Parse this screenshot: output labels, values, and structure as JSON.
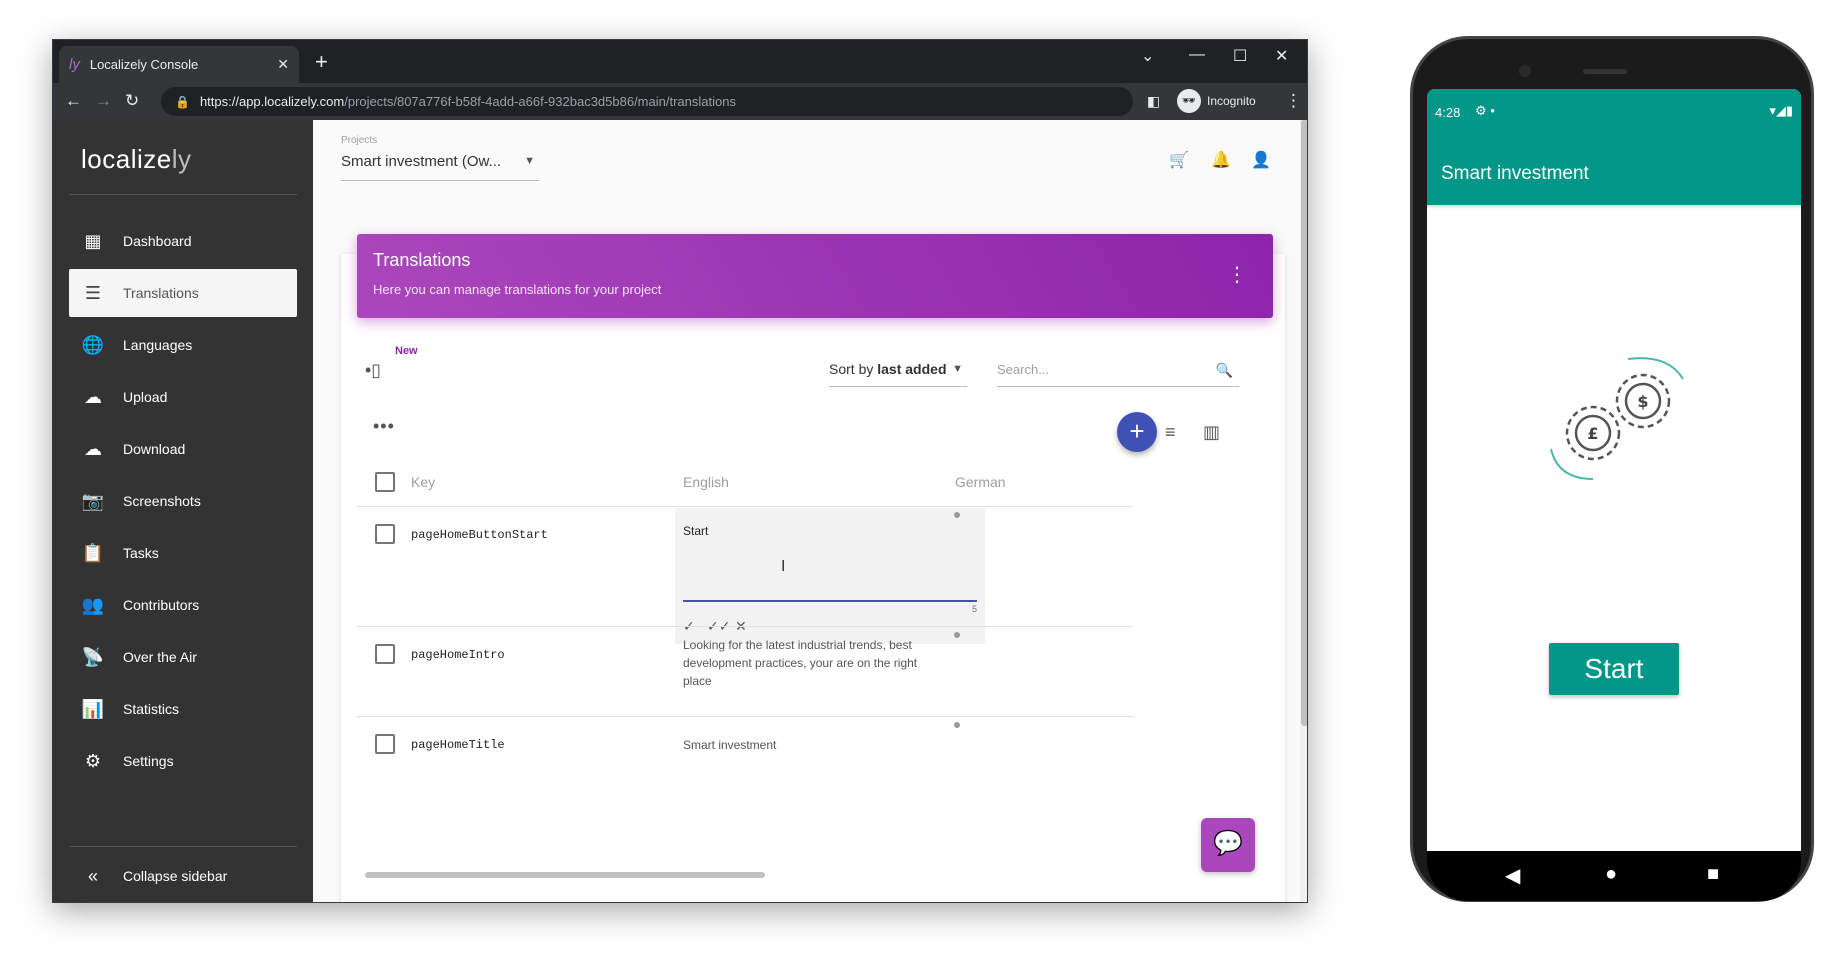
{
  "browser": {
    "tab_title": "Localizely Console",
    "tab_favicon": "ly",
    "url_host": "https://app.localizely.com",
    "url_path": "/projects/807a776f-b58f-4add-a66f-932bac3d5b86/main/translations",
    "profile_label": "Incognito"
  },
  "sidebar": {
    "logo_main": "localize",
    "logo_suffix": "ly",
    "items": [
      {
        "label": "Dashboard",
        "icon": "dashboard-icon"
      },
      {
        "label": "Translations",
        "icon": "translations-icon"
      },
      {
        "label": "Languages",
        "icon": "globe-icon"
      },
      {
        "label": "Upload",
        "icon": "cloud-upload-icon"
      },
      {
        "label": "Download",
        "icon": "cloud-download-icon"
      },
      {
        "label": "Screenshots",
        "icon": "camera-icon"
      },
      {
        "label": "Tasks",
        "icon": "clipboard-icon"
      },
      {
        "label": "Contributors",
        "icon": "people-icon"
      },
      {
        "label": "Over the Air",
        "icon": "antenna-icon"
      },
      {
        "label": "Statistics",
        "icon": "bar-chart-icon"
      },
      {
        "label": "Settings",
        "icon": "gear-icon"
      }
    ],
    "active_index": 1,
    "collapse_label": "Collapse sidebar"
  },
  "header": {
    "projects_label": "Projects",
    "project_name": "Smart investment (Ow..."
  },
  "banner": {
    "title": "Translations",
    "subtitle": "Here you can manage translations for your project"
  },
  "toolbar": {
    "new_badge": "New",
    "sort_prefix": "Sort by",
    "sort_value": "last added",
    "search_placeholder": "Search..."
  },
  "table": {
    "columns": [
      "Key",
      "English",
      "German"
    ],
    "rows": [
      {
        "key": "pageHomeButtonStart",
        "english": "Start",
        "german": "",
        "editing": true,
        "char_count": "5"
      },
      {
        "key": "pageHomeIntro",
        "english": "Looking for the latest industrial trends, best development practices, your are on the right place",
        "german": ""
      },
      {
        "key": "pageHomeTitle",
        "english": "Smart investment",
        "german": ""
      }
    ]
  },
  "phone": {
    "time": "4:28",
    "app_title": "Smart investment",
    "start_label": "Start",
    "accent_color": "#009688"
  },
  "colors": {
    "sidebar_bg": "#333333",
    "banner": "#9c27b0",
    "fab": "#3f51b5"
  }
}
